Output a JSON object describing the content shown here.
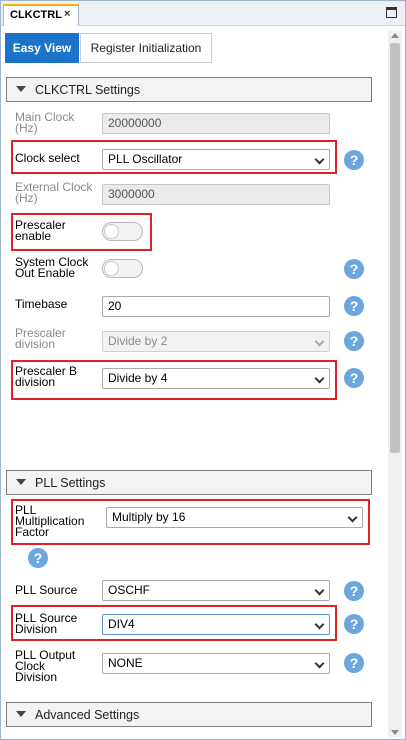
{
  "window": {
    "tab_label": "CLKCTRL",
    "tab_close": "×"
  },
  "view_tabs": [
    {
      "label": "Easy View",
      "active": true
    },
    {
      "label": "Register Initialization",
      "active": false
    }
  ],
  "sections": {
    "clkctrl": "CLKCTRL Settings",
    "pll": "PLL Settings",
    "advanced": "Advanced Settings"
  },
  "fields": {
    "main_clock": {
      "label": "Main Clock (Hz)",
      "value": "20000000",
      "enabled": false
    },
    "clock_select": {
      "label": "Clock select",
      "value": "PLL Oscillator"
    },
    "external_clock": {
      "label": "External Clock (Hz)",
      "value": "3000000",
      "enabled": false
    },
    "prescaler_enable": {
      "label": "Prescaler enable",
      "on": false
    },
    "system_clock_out": {
      "label": "System Clock Out Enable",
      "on": false
    },
    "timebase": {
      "label": "Timebase",
      "value": "20"
    },
    "prescaler_division": {
      "label": "Prescaler division",
      "value": "Divide by 2",
      "enabled": false
    },
    "prescaler_b_division": {
      "label": "Prescaler B division",
      "value": "Divide by 4"
    },
    "pll_multiplication": {
      "label": "PLL Multiplication Factor",
      "value": "Multiply by 16"
    },
    "pll_source": {
      "label": "PLL Source",
      "value": "OSCHF"
    },
    "pll_source_division": {
      "label": "PLL Source Division",
      "value": "DIV4"
    },
    "pll_output_clock_division": {
      "label": "PLL Output Clock Division",
      "value": "NONE"
    }
  },
  "help_glyph": "?",
  "colors": {
    "accent": "#1c74c8",
    "highlight": "#e0212a",
    "help_icon": "#6ca6df",
    "tab_top": "#f5b400"
  }
}
